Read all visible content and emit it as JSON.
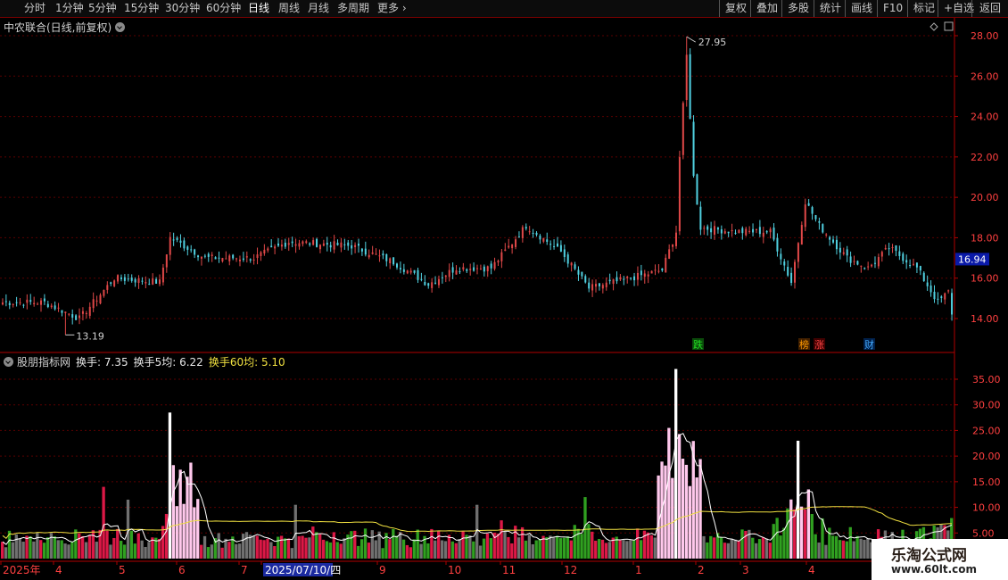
{
  "toolbar": {
    "left": [
      "分时",
      "1分钟",
      "5分钟",
      "15分钟",
      "30分钟",
      "60分钟",
      "日线",
      "周线",
      "月线",
      "多周期",
      "更多"
    ],
    "active": "日线",
    "right": [
      "复权",
      "叠加",
      "多股",
      "统计",
      "画线",
      "F10",
      "标记",
      "+自选",
      "返回"
    ]
  },
  "main": {
    "title": "中农联合(日线,前复权)",
    "high_label": "27.95",
    "low_label": "13.19",
    "current_price": "16.94",
    "y_ticks": [
      "28.00",
      "26.00",
      "24.00",
      "22.00",
      "20.00",
      "18.00",
      "16.00",
      "14.00"
    ],
    "y_range": [
      13.0,
      28.6
    ],
    "events": [
      {
        "text": "跌",
        "color": "#22dd22"
      },
      {
        "text": "榜",
        "color": "#ff9900"
      },
      {
        "text": "涨",
        "color": "#ff4444"
      },
      {
        "text": "财",
        "color": "#44aaff"
      }
    ]
  },
  "indicator": {
    "name": "股朋指标网",
    "labels": [
      "换手: 7.35",
      "换手5均: 6.22",
      "换手60均: 5.10"
    ],
    "label_colors": [
      "#e8e8e8",
      "#e8e8e8",
      "#f0e040"
    ],
    "y_ticks": [
      "35.00",
      "30.00",
      "25.00",
      "20.00",
      "15.00",
      "10.00",
      "5.00"
    ],
    "y_range": [
      0,
      38.5
    ]
  },
  "date_axis": {
    "labels": [
      "2025年",
      "4",
      "5",
      "6",
      "7",
      "2025/07/10/四",
      "9",
      "10",
      "11",
      "12",
      "1",
      "2",
      "3",
      "4"
    ]
  },
  "watermark": {
    "title": "乐淘公式网",
    "url": "www.60lt.com"
  },
  "colors": {
    "up": "#e04848",
    "down": "#50d0e0",
    "grid": "#5a0000",
    "axis_text": "#ff4040",
    "vol_up": "#dc1846",
    "vol_down": "#30a020",
    "vol_flat": "#707070",
    "vol_highlight": "#ffc8ec",
    "ma5": "#ffffff",
    "ma60": "#f0e040"
  },
  "chart_data": {
    "type": "candlestick",
    "title": "中农联合(日线,前复权)",
    "anchors": [
      {
        "bar": 0,
        "price": 14.8
      },
      {
        "bar": 12,
        "price": 14.8
      },
      {
        "bar": 22,
        "price": 14.0
      },
      {
        "bar": 32,
        "price": 16.0
      },
      {
        "bar": 45,
        "price": 15.8
      },
      {
        "bar": 48,
        "price": 18.0
      },
      {
        "bar": 58,
        "price": 17.0
      },
      {
        "bar": 72,
        "price": 17.0
      },
      {
        "bar": 82,
        "price": 17.8
      },
      {
        "bar": 100,
        "price": 17.6
      },
      {
        "bar": 112,
        "price": 16.8
      },
      {
        "bar": 122,
        "price": 15.7
      },
      {
        "bar": 130,
        "price": 16.5
      },
      {
        "bar": 140,
        "price": 16.5
      },
      {
        "bar": 150,
        "price": 18.6
      },
      {
        "bar": 160,
        "price": 17.3
      },
      {
        "bar": 168,
        "price": 15.5
      },
      {
        "bar": 180,
        "price": 16.0
      },
      {
        "bar": 189,
        "price": 16.4
      },
      {
        "bar": 193,
        "price": 18.3
      },
      {
        "bar": 194,
        "price": 22.0
      },
      {
        "bar": 196,
        "price": 27.0
      },
      {
        "bar": 198,
        "price": 21.0
      },
      {
        "bar": 200,
        "price": 18.5
      },
      {
        "bar": 210,
        "price": 18.3
      },
      {
        "bar": 220,
        "price": 18.3
      },
      {
        "bar": 226,
        "price": 15.8
      },
      {
        "bar": 230,
        "price": 19.8
      },
      {
        "bar": 234,
        "price": 18.6
      },
      {
        "bar": 242,
        "price": 17.0
      },
      {
        "bar": 248,
        "price": 16.5
      },
      {
        "bar": 254,
        "price": 17.5
      },
      {
        "bar": 262,
        "price": 16.5
      },
      {
        "bar": 268,
        "price": 14.8
      },
      {
        "bar": 272,
        "price": 15.5
      }
    ],
    "highs": [
      {
        "bar": 196,
        "price": 27.95
      }
    ],
    "lows": [
      {
        "bar": 18,
        "price": 13.19
      }
    ],
    "last_close": 14.2
  }
}
